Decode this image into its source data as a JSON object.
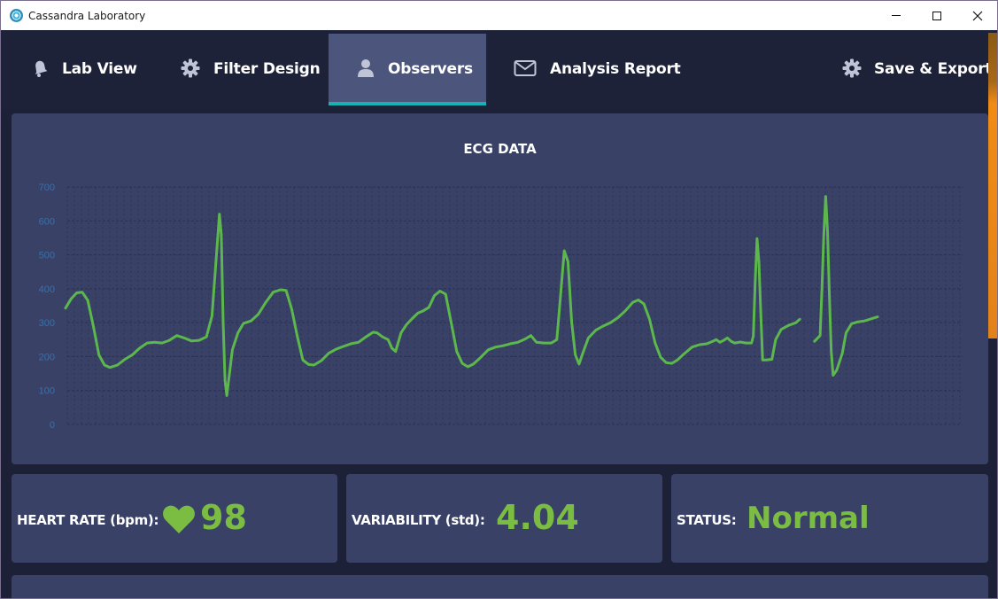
{
  "window": {
    "title": "Cassandra Laboratory"
  },
  "nav": {
    "items": [
      {
        "label": "Lab View",
        "icon": "bell-icon"
      },
      {
        "label": "Filter Design",
        "icon": "gear-icon"
      },
      {
        "label": "Observers",
        "icon": "user-icon",
        "active": true
      },
      {
        "label": "Analysis Report",
        "icon": "envelope-icon"
      },
      {
        "label": "Save & Export",
        "icon": "gear-icon"
      }
    ]
  },
  "stats": {
    "heart_rate_label": "HEART RATE (bpm):",
    "heart_rate_value": "98",
    "variability_label": "VARIABILITY (std):",
    "variability_value": "4.04",
    "status_label": "STATUS:",
    "status_value": "Normal"
  },
  "colors": {
    "accent": "#7bbd42",
    "active_tab": "#4c567c",
    "active_underline": "#17b3b4",
    "panel": "#394166",
    "background": "#1d2137",
    "axis_text": "#3b6fa8"
  },
  "chart_data": {
    "type": "line",
    "title": "ECG DATA",
    "xlabel": "",
    "ylabel": "",
    "ylim": [
      0,
      700
    ],
    "yticks": [
      "0",
      "100",
      "200",
      "300",
      "400",
      "500",
      "600",
      "700"
    ],
    "grid": true,
    "series": [
      {
        "color": "#5cb84c",
        "segments": [
          [
            [
              0,
              343
            ],
            [
              3,
              370
            ],
            [
              6,
              388
            ],
            [
              9,
              390
            ],
            [
              12,
              366
            ],
            [
              15,
              290
            ],
            [
              18,
              205
            ],
            [
              21,
              175
            ],
            [
              24,
              168
            ],
            [
              28,
              175
            ],
            [
              32,
              192
            ],
            [
              36,
              205
            ],
            [
              40,
              225
            ],
            [
              44,
              240
            ],
            [
              48,
              242
            ],
            [
              52,
              240
            ],
            [
              56,
              248
            ],
            [
              60,
              262
            ],
            [
              64,
              255
            ],
            [
              68,
              246
            ],
            [
              72,
              248
            ],
            [
              76,
              258
            ],
            [
              79,
              320
            ],
            [
              81,
              470
            ],
            [
              83,
              620
            ],
            [
              84,
              560
            ],
            [
              85,
              300
            ],
            [
              86,
              130
            ],
            [
              87,
              85
            ],
            [
              88,
              130
            ],
            [
              90,
              220
            ],
            [
              93,
              270
            ],
            [
              96,
              298
            ],
            [
              100,
              305
            ],
            [
              104,
              325
            ],
            [
              108,
              360
            ],
            [
              112,
              390
            ],
            [
              116,
              397
            ],
            [
              119,
              395
            ],
            [
              122,
              340
            ],
            [
              125,
              260
            ],
            [
              128,
              190
            ],
            [
              131,
              177
            ],
            [
              134,
              175
            ],
            [
              138,
              188
            ],
            [
              142,
              210
            ],
            [
              146,
              222
            ],
            [
              150,
              230
            ],
            [
              154,
              238
            ],
            [
              158,
              242
            ],
            [
              162,
              258
            ],
            [
              166,
              272
            ],
            [
              168,
              270
            ],
            [
              171,
              258
            ],
            [
              174,
              250
            ],
            [
              176,
              225
            ],
            [
              178,
              215
            ],
            [
              181,
              270
            ],
            [
              184,
              295
            ],
            [
              187,
              312
            ],
            [
              190,
              328
            ],
            [
              193,
              335
            ],
            [
              196,
              345
            ],
            [
              199,
              380
            ],
            [
              202,
              393
            ],
            [
              205,
              384
            ],
            [
              208,
              300
            ],
            [
              211,
              215
            ],
            [
              214,
              180
            ],
            [
              217,
              170
            ],
            [
              220,
              178
            ],
            [
              224,
              198
            ],
            [
              228,
              220
            ],
            [
              232,
              228
            ],
            [
              236,
              232
            ],
            [
              240,
              238
            ],
            [
              244,
              242
            ],
            [
              248,
              252
            ],
            [
              251,
              262
            ],
            [
              254,
              242
            ],
            [
              258,
              240
            ],
            [
              262,
              240
            ],
            [
              265,
              250
            ],
            [
              267,
              380
            ],
            [
              269,
              512
            ],
            [
              271,
              480
            ],
            [
              273,
              300
            ],
            [
              275,
              205
            ],
            [
              277,
              178
            ],
            [
              279,
              210
            ],
            [
              282,
              255
            ],
            [
              286,
              278
            ],
            [
              290,
              290
            ],
            [
              294,
              300
            ],
            [
              298,
              315
            ],
            [
              302,
              335
            ],
            [
              306,
              360
            ],
            [
              309,
              367
            ],
            [
              312,
              355
            ],
            [
              315,
              310
            ],
            [
              318,
              240
            ],
            [
              321,
              198
            ],
            [
              324,
              182
            ],
            [
              327,
              180
            ],
            [
              330,
              190
            ],
            [
              334,
              210
            ],
            [
              338,
              228
            ],
            [
              342,
              235
            ],
            [
              346,
              238
            ],
            [
              349,
              245
            ],
            [
              351,
              250
            ],
            [
              353,
              242
            ],
            [
              355,
              248
            ],
            [
              357,
              255
            ],
            [
              359,
              245
            ],
            [
              361,
              240
            ],
            [
              364,
              243
            ],
            [
              367,
              240
            ],
            [
              370,
              240
            ],
            [
              371,
              260
            ],
            [
              372,
              420
            ],
            [
              373,
              548
            ],
            [
              374,
              480
            ],
            [
              375,
              330
            ],
            [
              376,
              190
            ],
            [
              378,
              190
            ],
            [
              381,
              192
            ],
            [
              383,
              250
            ],
            [
              386,
              280
            ],
            [
              390,
              292
            ],
            [
              394,
              300
            ],
            [
              396,
              310
            ]
          ],
          [
            [
              404,
              245
            ],
            [
              407,
              262
            ],
            [
              408,
              400
            ],
            [
              409,
              560
            ],
            [
              410,
              672
            ],
            [
              411,
              570
            ],
            [
              412,
              380
            ],
            [
              413,
              215
            ],
            [
              414,
              145
            ],
            [
              416,
              160
            ],
            [
              419,
              210
            ],
            [
              421,
              270
            ],
            [
              424,
              297
            ],
            [
              427,
              302
            ],
            [
              431,
              305
            ],
            [
              435,
              312
            ],
            [
              438,
              317
            ]
          ]
        ]
      }
    ]
  }
}
